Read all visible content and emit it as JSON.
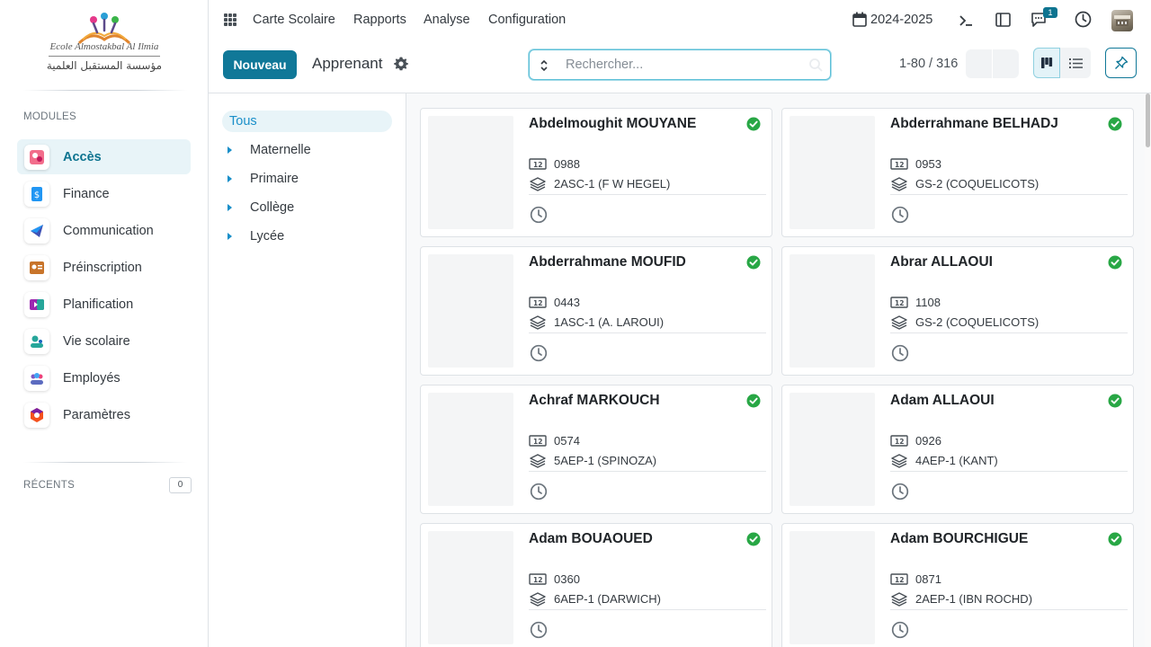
{
  "logo": {
    "name_latin": "Ecole Almostakbal Al Ilmia",
    "name_arabic": "مؤسسة المستقبل العلمية"
  },
  "sidebar": {
    "modules_title": "MODULES",
    "recents_title": "RÉCENTS",
    "recents_count": "0",
    "items": [
      {
        "label": "Accès",
        "icon": "access-icon",
        "active": true
      },
      {
        "label": "Finance",
        "icon": "finance-icon"
      },
      {
        "label": "Communication",
        "icon": "communication-icon"
      },
      {
        "label": "Préinscription",
        "icon": "preinscription-icon"
      },
      {
        "label": "Planification",
        "icon": "planification-icon"
      },
      {
        "label": "Vie scolaire",
        "icon": "vie-scolaire-icon"
      },
      {
        "label": "Employés",
        "icon": "employes-icon"
      },
      {
        "label": "Paramètres",
        "icon": "parametres-icon"
      }
    ]
  },
  "topbar": {
    "menu": [
      "Carte Scolaire",
      "Rapports",
      "Analyse",
      "Configuration"
    ],
    "year": "2024-2025",
    "messages_badge": "1"
  },
  "control": {
    "new_label": "Nouveau",
    "breadcrumb": "Apprenant",
    "search_placeholder": "Rechercher...",
    "pager": "1-80 / 316"
  },
  "filters": [
    {
      "label": "Tous",
      "active": true
    },
    {
      "label": "Maternelle"
    },
    {
      "label": "Primaire"
    },
    {
      "label": "Collège"
    },
    {
      "label": "Lycée"
    }
  ],
  "students": [
    {
      "name": "Abdelmoughit MOUYANE",
      "id": "0988",
      "class": "2ASC-1 (F W HEGEL)"
    },
    {
      "name": "Abderrahmane BELHADJ",
      "id": "0953",
      "class": "GS-2 (COQUELICOTS)"
    },
    {
      "name": "Abderrahmane MOUFID",
      "id": "0443",
      "class": "1ASC-1 (A. LAROUI)"
    },
    {
      "name": "Abrar ALLAOUI",
      "id": "1108",
      "class": "GS-2 (COQUELICOTS)"
    },
    {
      "name": "Achraf MARKOUCH",
      "id": "0574",
      "class": "5AEP-1 (SPINOZA)"
    },
    {
      "name": "Adam ALLAOUI",
      "id": "0926",
      "class": "4AEP-1 (KANT)"
    },
    {
      "name": "Adam BOUAOUED",
      "id": "0360",
      "class": "6AEP-1 (DARWICH)"
    },
    {
      "name": "Adam BOURCHIGUE",
      "id": "0871",
      "class": "2AEP-1 (IBN ROCHD)"
    }
  ],
  "colors": {
    "primary": "#107898",
    "accent": "#1a8fc9",
    "status_ok": "#28a745"
  }
}
